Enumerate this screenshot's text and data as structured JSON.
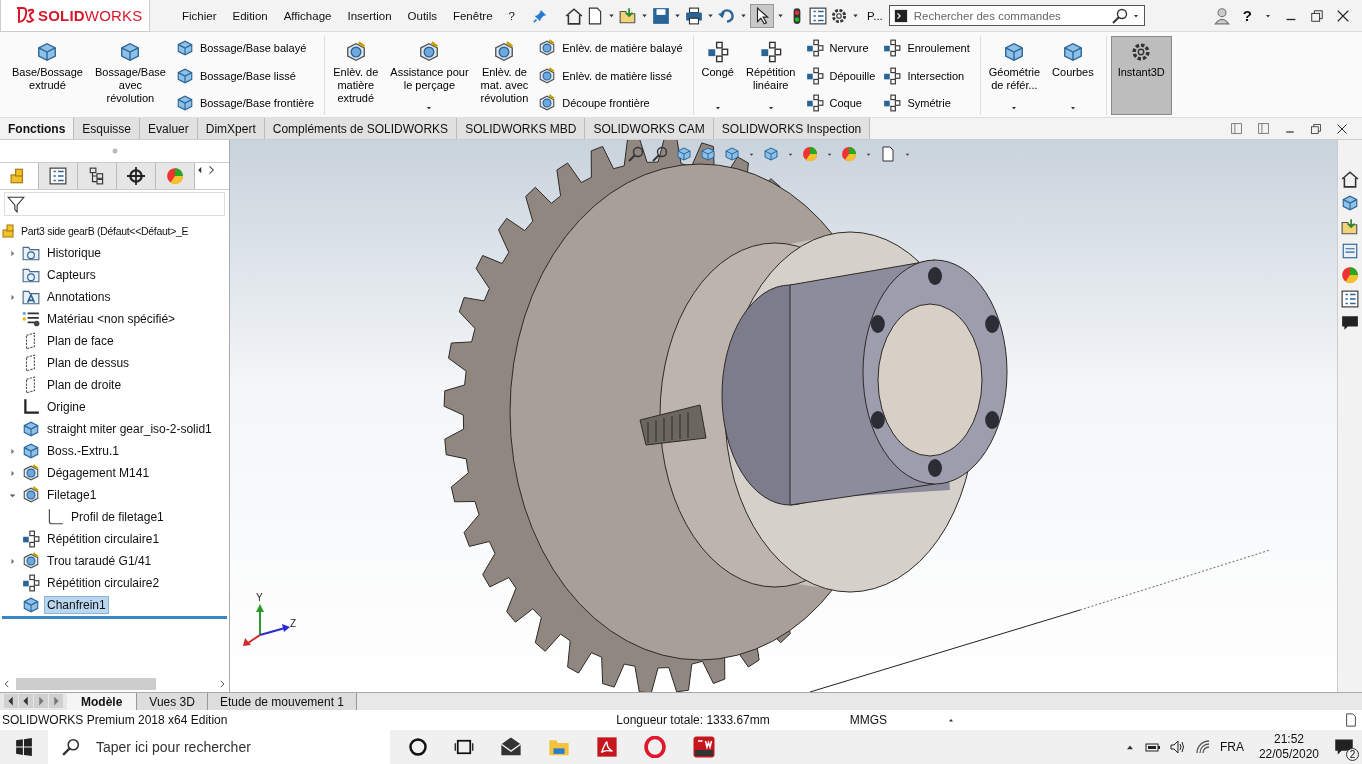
{
  "app": {
    "logo": "**SOLID**WORKS",
    "menu": [
      "Fichier",
      "Edition",
      "Affichage",
      "Insertion",
      "Outils",
      "Fenêtre",
      "?"
    ],
    "select_tool": {
      "selected": true
    },
    "quick_label": "P...",
    "search": {
      "placeholder": "Rechercher des commandes"
    },
    "help": "?"
  },
  "ribbon": {
    "groups": [
      {
        "items": [
          {
            "kind": "large",
            "label": "Base/Bossage\nextrudé",
            "dropdown": false,
            "selected": false
          },
          {
            "kind": "large",
            "label": "Bossage/Base\navec\nrévolution",
            "dropdown": false,
            "selected": false
          },
          {
            "kind": "stack",
            "labels": [
              "Bossage/Base balayé",
              "Bossage/Base lissé",
              "Bossage/Base frontière"
            ]
          }
        ]
      },
      {
        "items": [
          {
            "kind": "large",
            "label": "Enlèv. de\nmatière\nextrudé",
            "dropdown": false,
            "selected": false
          },
          {
            "kind": "large",
            "label": "Assistance pour\nle perçage",
            "dropdown": true,
            "selected": false
          },
          {
            "kind": "large",
            "label": "Enlèv. de\nmat. avec\nrévolution",
            "dropdown": false,
            "selected": false
          },
          {
            "kind": "stack",
            "labels": [
              "Enlèv. de matière balayé",
              "Enlèv. de matière lissé",
              "Découpe frontière"
            ]
          }
        ]
      },
      {
        "items": [
          {
            "kind": "large",
            "label": "Congé",
            "dropdown": true,
            "selected": false
          },
          {
            "kind": "large",
            "label": "Répétition\nlinéaire",
            "dropdown": true,
            "selected": false
          },
          {
            "kind": "stack",
            "labels": [
              "Nervure",
              "Dépouille",
              "Coque"
            ]
          },
          {
            "kind": "stack",
            "labels": [
              "Enroulement",
              "Intersection",
              "Symétrie"
            ]
          }
        ]
      },
      {
        "items": [
          {
            "kind": "large",
            "label": "Géométrie\nde référ...",
            "dropdown": true,
            "selected": false
          },
          {
            "kind": "large",
            "label": "Courbes",
            "dropdown": true,
            "selected": false
          }
        ]
      },
      {
        "items": [
          {
            "kind": "large",
            "label": "Instant3D",
            "dropdown": false,
            "selected": true
          }
        ]
      }
    ]
  },
  "command_tabs": [
    {
      "label": "Fonctions",
      "selected": true
    },
    {
      "label": "Esquisse",
      "selected": false
    },
    {
      "label": "Evaluer",
      "selected": false
    },
    {
      "label": "DimXpert",
      "selected": false
    },
    {
      "label": "Compléments de SOLIDWORKS",
      "selected": false
    },
    {
      "label": "SOLIDWORKS MBD",
      "selected": false
    },
    {
      "label": "SOLIDWORKS CAM",
      "selected": false
    },
    {
      "label": "SOLIDWORKS Inspection",
      "selected": false
    }
  ],
  "panel_tabs": [
    {
      "selected": true
    },
    {
      "selected": false
    },
    {
      "selected": false
    },
    {
      "selected": false
    },
    {
      "selected": false
    }
  ],
  "tree": {
    "root": "Part3 side gearB (Défaut<<Défaut>_E",
    "items": [
      {
        "label": "Historique",
        "kind": "history",
        "expanded": false,
        "selected": false
      },
      {
        "label": "Capteurs",
        "kind": "sensor",
        "selected": false
      },
      {
        "label": "Annotations",
        "kind": "annotation",
        "expanded": false,
        "selected": false
      },
      {
        "label": "Matériau <non spécifié>",
        "kind": "material",
        "selected": false
      },
      {
        "label": "Plan de face",
        "kind": "plane",
        "selected": false
      },
      {
        "label": "Plan de dessus",
        "kind": "plane",
        "selected": false
      },
      {
        "label": "Plan de droite",
        "kind": "plane",
        "selected": false
      },
      {
        "label": "Origine",
        "kind": "origin",
        "selected": false
      },
      {
        "label": "straight miter gear_iso-2-solid1",
        "kind": "body",
        "selected": false
      },
      {
        "label": "Boss.-Extru.1",
        "kind": "extrude",
        "expanded": false,
        "selected": false
      },
      {
        "label": "Dégagement M141",
        "kind": "hole",
        "expanded": false,
        "selected": false
      },
      {
        "label": "Filetage1",
        "kind": "thread",
        "expanded": true,
        "selected": false,
        "children": [
          {
            "label": "Profil de filetage1",
            "kind": "sketch",
            "selected": false
          }
        ]
      },
      {
        "label": "Répétition circulaire1",
        "kind": "pattern",
        "selected": false
      },
      {
        "label": "Trou taraudé G1/41",
        "kind": "hole",
        "expanded": false,
        "selected": false
      },
      {
        "label": "Répétition circulaire2",
        "kind": "pattern",
        "selected": false
      },
      {
        "label": "Chanfrein1",
        "kind": "chamfer",
        "selected": true
      }
    ]
  },
  "viewport": {
    "triad": [
      "Y",
      "Z"
    ]
  },
  "bottom_tabs": [
    {
      "label": "Modèle",
      "selected": true
    },
    {
      "label": "Vues 3D",
      "selected": false
    },
    {
      "label": "Etude de mouvement 1",
      "selected": false
    }
  ],
  "status_bar": {
    "edition": "SOLIDWORKS Premium 2018 x64 Edition",
    "length": "Longueur totale: 1333.67mm",
    "units": "MMGS"
  },
  "taskbar": {
    "search": {
      "placeholder": "Taper ici pour rechercher"
    },
    "language": "FRA",
    "time": "21:52",
    "date": "22/05/2020",
    "notifications": "2"
  }
}
